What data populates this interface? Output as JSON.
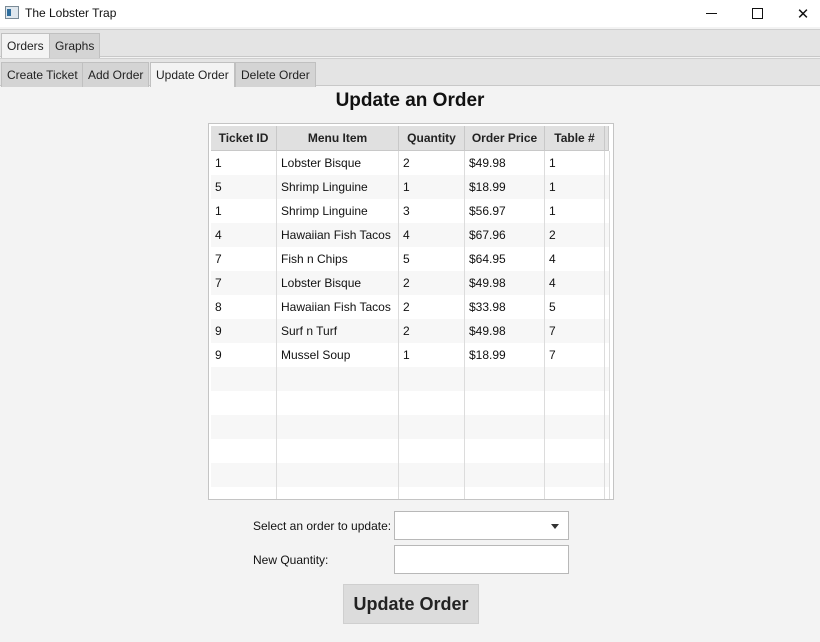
{
  "window": {
    "title": "The Lobster Trap",
    "minimize_glyph": "—",
    "maximize_glyph": "☐",
    "close_glyph": "✕"
  },
  "main_tabs": [
    {
      "label": "Orders",
      "active": true
    },
    {
      "label": "Graphs",
      "active": false
    }
  ],
  "sub_tabs": [
    {
      "label": "Create Ticket",
      "active": false
    },
    {
      "label": "Add Order",
      "active": false
    },
    {
      "label": "Update Order",
      "active": true
    },
    {
      "label": "Delete Order",
      "active": false
    }
  ],
  "heading": "Update an Order",
  "table": {
    "columns": [
      "Ticket ID",
      "Menu Item",
      "Quantity",
      "Order Price",
      "Table #"
    ],
    "rows": [
      [
        "1",
        "Lobster Bisque",
        "2",
        "$49.98",
        "1"
      ],
      [
        "5",
        "Shrimp Linguine",
        "1",
        "$18.99",
        "1"
      ],
      [
        "1",
        "Shrimp Linguine",
        "3",
        "$56.97",
        "1"
      ],
      [
        "4",
        "Hawaiian Fish Tacos",
        "4",
        "$67.96",
        "2"
      ],
      [
        "7",
        "Fish n Chips",
        "5",
        "$64.95",
        "4"
      ],
      [
        "7",
        "Lobster Bisque",
        "2",
        "$49.98",
        "4"
      ],
      [
        "8",
        "Hawaiian Fish Tacos",
        "2",
        "$33.98",
        "5"
      ],
      [
        "9",
        "Surf n Turf",
        "2",
        "$49.98",
        "7"
      ],
      [
        "9",
        "Mussel Soup",
        "1",
        "$18.99",
        "7"
      ]
    ],
    "empty_rows": 6
  },
  "form": {
    "select_label": "Select an order to update:",
    "select_value": "",
    "quantity_label": "New Quantity:",
    "quantity_value": "",
    "submit_label": "Update Order"
  }
}
